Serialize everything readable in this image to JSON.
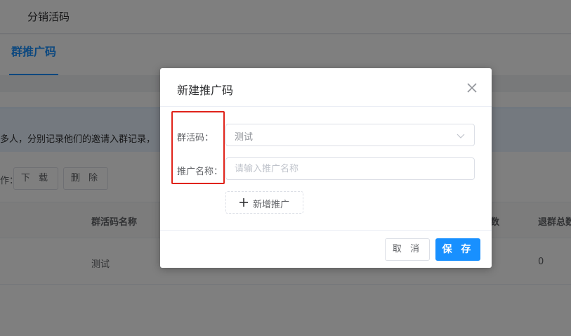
{
  "header": {
    "title": "分销活码"
  },
  "tabs": [
    {
      "label": "群推广码",
      "active": true
    }
  ],
  "notice": {
    "text": "多人，分别记录他们的邀请入群记录，"
  },
  "operations": {
    "label": "作：",
    "download": "下 载",
    "delete": "删 除"
  },
  "table": {
    "columns": [
      "群活码名称",
      "数",
      "退群总数"
    ],
    "rows": [
      {
        "name": "测试",
        "exit_total": "0"
      }
    ]
  },
  "dialog": {
    "title": "新建推广码",
    "close_icon": "close-icon",
    "fields": {
      "group_label": "群活码：",
      "group_value": "测试",
      "name_label": "推广名称：",
      "name_placeholder": "请输入推广名称",
      "name_value": ""
    },
    "add_button": "新增推广",
    "cancel_button": "取 消",
    "save_button": "保 存"
  },
  "colors": {
    "primary": "#1890ff",
    "highlight": "#e0231a",
    "notice_bg": "#e8f3fe"
  }
}
